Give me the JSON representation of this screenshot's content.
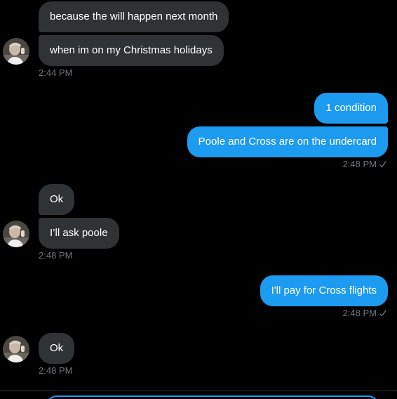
{
  "conversation": {
    "messages": [
      {
        "text": "because the will happen next month"
      },
      {
        "text": "when im on my Christmas holidays"
      },
      {
        "text": "1 condition"
      },
      {
        "text": "Poole and Cross are on the undercard"
      },
      {
        "text": "Ok"
      },
      {
        "text": "I’ll ask poole"
      },
      {
        "text": "I'll pay for Cross flights"
      },
      {
        "text": "Ok"
      }
    ],
    "timestamps": [
      "2:44 PM",
      "2:48 PM",
      "2:48 PM",
      "2:48 PM",
      "2:48 PM"
    ]
  },
  "colors": {
    "background": "#000000",
    "incoming_bubble": "#2f3336",
    "outgoing_bubble": "#1d9bf0",
    "timestamp": "#71767b"
  },
  "icons": {
    "avatar": "avatar-photo",
    "read_receipt": "check-icon"
  }
}
